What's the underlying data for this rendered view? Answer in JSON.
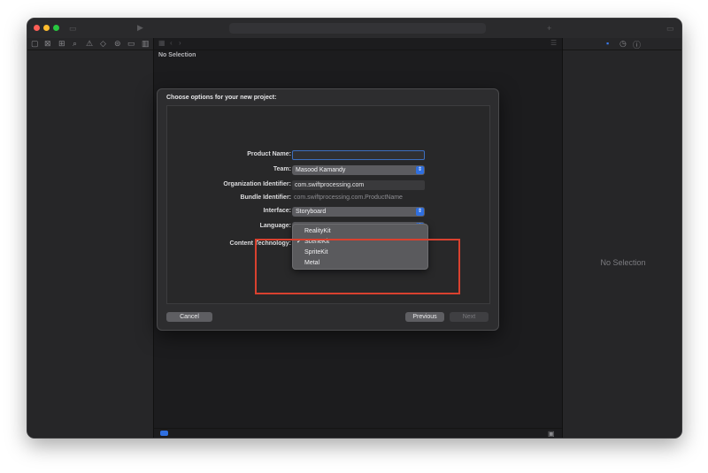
{
  "icons": {
    "run": "play-icon",
    "sidebar_toggle": "sidebar-icon",
    "navigator": [
      "folder-icon",
      "source-control-icon",
      "symbol-icon",
      "search-icon",
      "warning-icon",
      "test-icon",
      "debug-icon",
      "breakpoint-icon",
      "report-icon"
    ],
    "inspector": [
      "file-inspector-icon",
      "history-icon",
      "help-icon"
    ]
  },
  "editor": {
    "jump_bar": "No Selection"
  },
  "inspector": {
    "empty_text": "No Selection"
  },
  "dialog": {
    "title": "Choose options for your new project:",
    "fields": {
      "product_name_label": "Product Name:",
      "product_name_value": "",
      "team_label": "Team:",
      "team_value": "Masood Kamandy",
      "org_id_label": "Organization Identifier:",
      "org_id_value": "com.swiftprocessing.com",
      "bundle_id_label": "Bundle Identifier:",
      "bundle_id_value": "com.swiftprocessing.com.ProductName",
      "interface_label": "Interface:",
      "interface_value": "Storyboard",
      "language_label": "Language:",
      "content_tech_label": "Content Technology:"
    },
    "menu": {
      "options": [
        "RealityKit",
        "SceneKit",
        "SpriteKit",
        "Metal"
      ],
      "selected": "SceneKit",
      "check_glyph": "✓"
    },
    "buttons": {
      "cancel": "Cancel",
      "previous": "Previous",
      "next": "Next"
    }
  },
  "colors": {
    "accent": "#2f6fe0",
    "highlight_box": "#d9412f"
  }
}
